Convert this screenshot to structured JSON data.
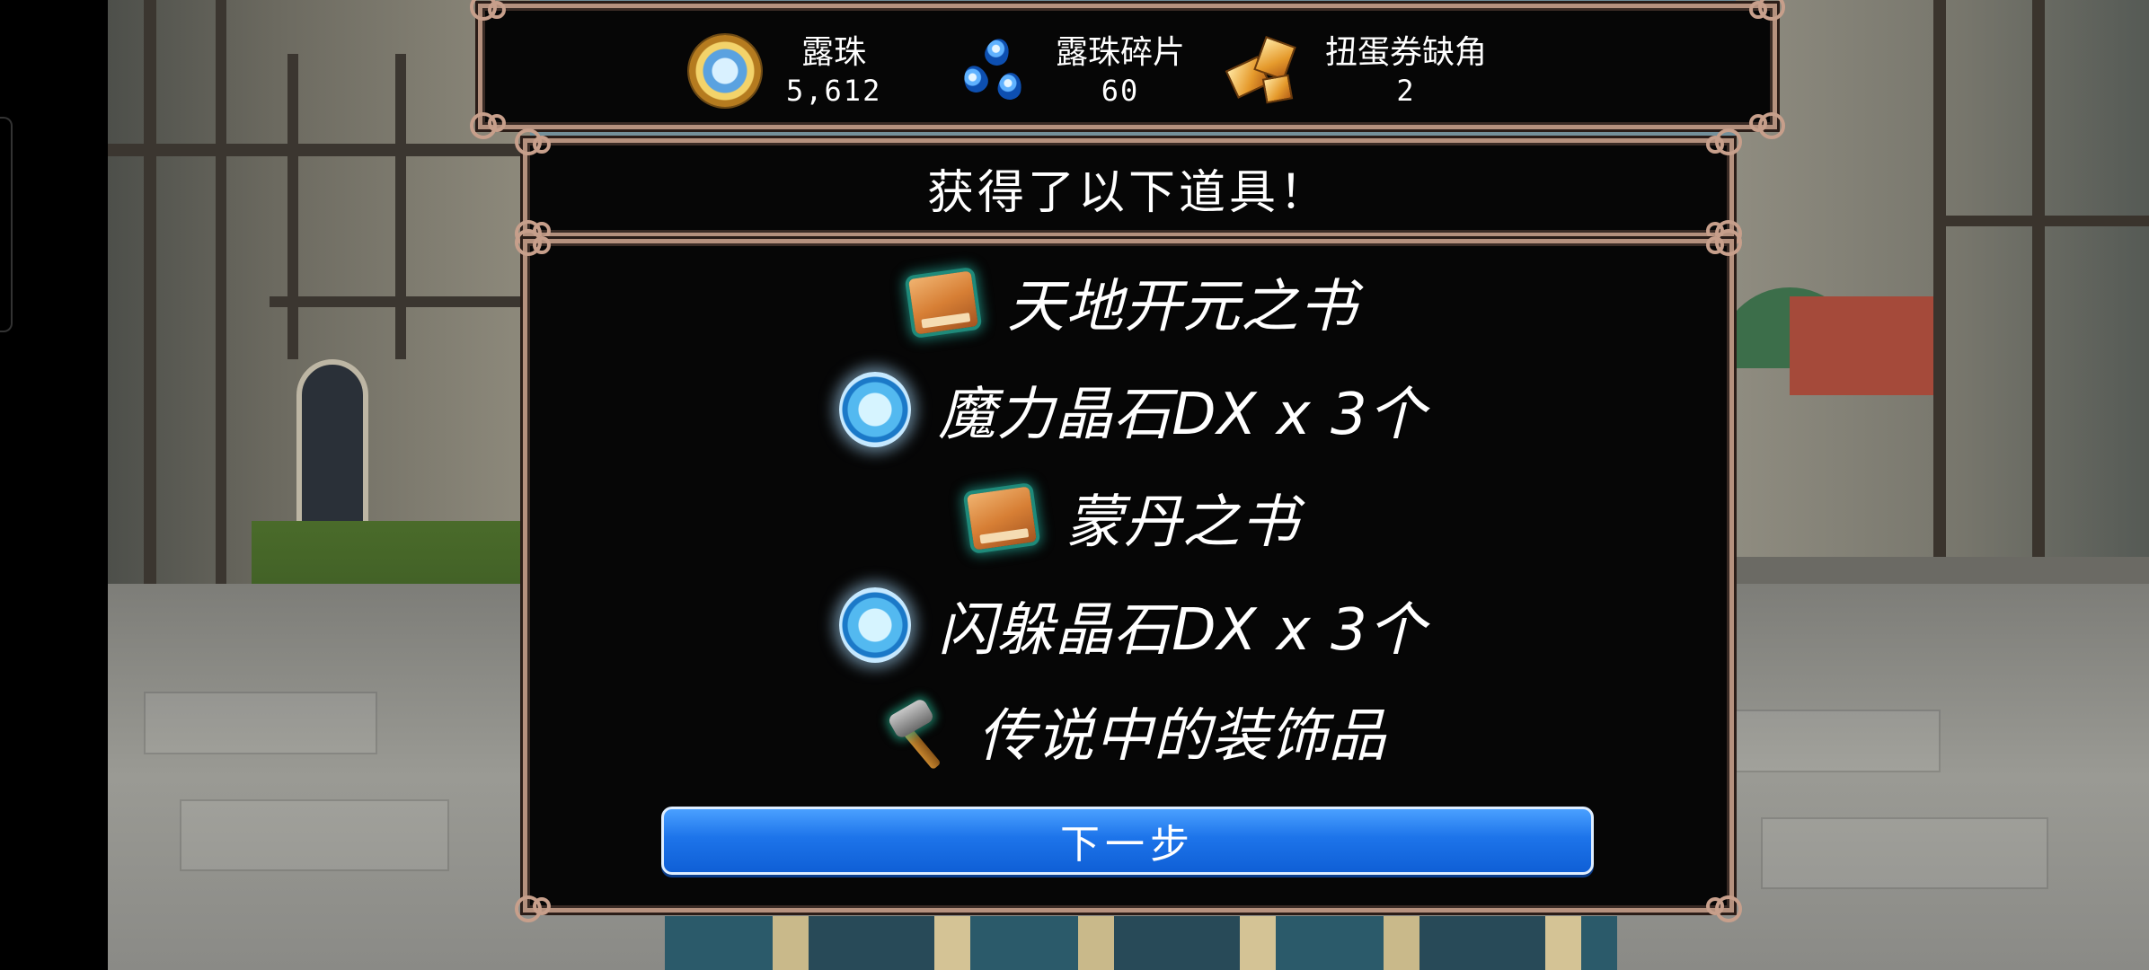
{
  "currencies": [
    {
      "label": "露珠",
      "value": "5,612",
      "icon": "lumi-orb-icon"
    },
    {
      "label": "露珠碎片",
      "value": "60",
      "icon": "lumi-fragment-icon"
    },
    {
      "label": "扭蛋券缺角",
      "value": "2",
      "icon": "gacha-ticket-shard-icon"
    }
  ],
  "dialog": {
    "title": "获得了以下道具！",
    "items": [
      {
        "name": "天地开元之书",
        "icon": "book-icon"
      },
      {
        "name": "魔力晶石DX x 3个",
        "icon": "crystal-icon"
      },
      {
        "name": "蒙丹之书",
        "icon": "book-icon"
      },
      {
        "name": "闪躲晶石DX x 3个",
        "icon": "crystal-icon"
      },
      {
        "name": "传说中的装饰品",
        "icon": "hammer-icon"
      }
    ],
    "next_label": "下一步"
  },
  "colors": {
    "frame_border": "#b5917e",
    "panel_bg": "#060606",
    "button_blue": "#1d74ea",
    "text": "#ffffff"
  }
}
